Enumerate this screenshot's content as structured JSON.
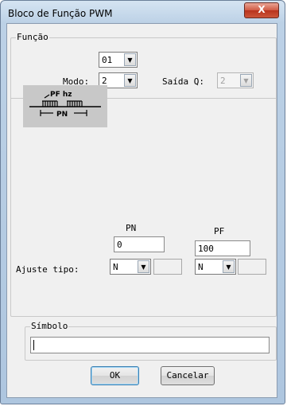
{
  "window": {
    "title": "Bloco de Função PWM",
    "close_label": "X"
  },
  "funcao": {
    "group_label": "Função",
    "number_value": "01",
    "modo_label": "Modo:",
    "modo_value": "2",
    "saida_label": "Saída Q:",
    "saida_value": "2"
  },
  "diagram": {
    "pf_label": "PF hz",
    "pn_label": "PN"
  },
  "params": {
    "pn_header": "PN",
    "pf_header": "PF",
    "pn_value": "0",
    "pf_value": "100",
    "ajuste_label": "Ajuste tipo:",
    "pn_tipo": "N",
    "pf_tipo": "N"
  },
  "simbolo": {
    "group_label": "Símbolo",
    "value": ""
  },
  "buttons": {
    "ok": "OK",
    "cancel": "Cancelar"
  },
  "colors": {
    "close_button": "#c9452f",
    "dialog_face": "#f0f0f0",
    "frame": "#bcd1e6"
  }
}
